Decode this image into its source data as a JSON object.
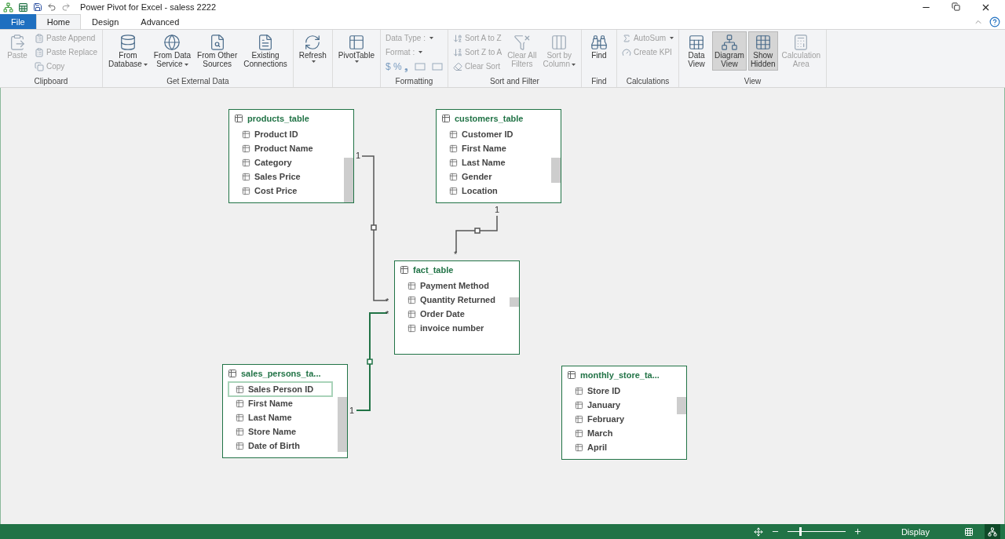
{
  "window": {
    "title": "Power Pivot for Excel - saless 2222"
  },
  "ribbon_tabs": [
    {
      "label": "File",
      "kind": "file",
      "selected": false
    },
    {
      "label": "Home",
      "kind": "tab",
      "selected": true
    },
    {
      "label": "Design",
      "kind": "tab",
      "selected": false
    },
    {
      "label": "Advanced",
      "kind": "tab",
      "selected": false
    }
  ],
  "ribbon_groups": [
    {
      "label": "Clipboard",
      "buttons": [
        {
          "kind": "large",
          "lines": [
            "Paste"
          ],
          "disabled": true,
          "dropdown": false
        },
        {
          "kind": "small",
          "lines": [
            "Paste Append"
          ],
          "disabled": true,
          "dropdown": false
        },
        {
          "kind": "small",
          "lines": [
            "Paste Replace"
          ],
          "disabled": true,
          "dropdown": false
        },
        {
          "kind": "small",
          "lines": [
            "Copy"
          ],
          "disabled": true,
          "dropdown": false
        }
      ]
    },
    {
      "label": "Get External Data",
      "buttons": [
        {
          "kind": "large",
          "lines": [
            "From",
            "Database"
          ],
          "disabled": false,
          "dropdown": true
        },
        {
          "kind": "large",
          "lines": [
            "From Data",
            "Service"
          ],
          "disabled": false,
          "dropdown": true
        },
        {
          "kind": "large",
          "lines": [
            "From Other",
            "Sources"
          ],
          "disabled": false,
          "dropdown": false
        },
        {
          "kind": "large",
          "lines": [
            "Existing",
            "Connections"
          ],
          "disabled": false,
          "dropdown": false
        }
      ]
    },
    {
      "buttons": [
        {
          "kind": "large",
          "lines": [
            "Refresh"
          ],
          "disabled": false,
          "dropdown": true
        }
      ]
    },
    {
      "buttons": [
        {
          "kind": "large",
          "lines": [
            "PivotTable"
          ],
          "disabled": false,
          "dropdown": true
        }
      ]
    },
    {
      "label": "Formatting",
      "buttons": [
        {
          "kind": "small",
          "lines": [
            "Data Type :"
          ],
          "disabled": true,
          "dropdown": true
        },
        {
          "kind": "small",
          "lines": [
            "Format :"
          ],
          "disabled": true,
          "dropdown": true
        },
        {
          "kind": "symbols",
          "lines": [
            "$",
            "%",
            "❟"
          ],
          "disabled": true,
          "dropdown": false
        }
      ]
    },
    {
      "label": "Sort and Filter",
      "buttons": [
        {
          "kind": "small",
          "lines": [
            "Sort A to Z"
          ],
          "disabled": true,
          "dropdown": false
        },
        {
          "kind": "small",
          "lines": [
            "Sort Z to A"
          ],
          "disabled": true,
          "dropdown": false
        },
        {
          "kind": "small",
          "lines": [
            "Clear Sort"
          ],
          "disabled": true,
          "dropdown": false
        },
        {
          "kind": "large",
          "lines": [
            "Clear All",
            "Filters"
          ],
          "disabled": true,
          "dropdown": false
        },
        {
          "kind": "large",
          "lines": [
            "Sort by",
            "Column"
          ],
          "disabled": true,
          "dropdown": true
        }
      ]
    },
    {
      "label": "Find",
      "buttons": [
        {
          "kind": "large",
          "lines": [
            "Find"
          ],
          "disabled": false,
          "dropdown": false
        }
      ]
    },
    {
      "label": "Calculations",
      "buttons": [
        {
          "kind": "small",
          "lines": [
            "AutoSum"
          ],
          "disabled": true,
          "dropdown": true
        },
        {
          "kind": "small",
          "lines": [
            "Create KPI"
          ],
          "disabled": true,
          "dropdown": false
        }
      ]
    },
    {
      "label": "View",
      "buttons": [
        {
          "kind": "large",
          "lines": [
            "Data",
            "View"
          ],
          "disabled": false,
          "dropdown": false,
          "selected": false
        },
        {
          "kind": "large",
          "lines": [
            "Diagram",
            "View"
          ],
          "disabled": false,
          "dropdown": false,
          "selected": true
        },
        {
          "kind": "large",
          "lines": [
            "Show",
            "Hidden"
          ],
          "disabled": false,
          "dropdown": false,
          "selected": true
        },
        {
          "kind": "large",
          "lines": [
            "Calculation",
            "Area"
          ],
          "disabled": true,
          "dropdown": false,
          "selected": false
        }
      ]
    }
  ],
  "diagram_tables": [
    {
      "title": "products_table",
      "rows": [
        {
          "label": "Product ID",
          "selected": false
        },
        {
          "label": "Product Name",
          "selected": false
        },
        {
          "label": "Category",
          "selected": false
        },
        {
          "label": "Sales Price",
          "selected": false
        },
        {
          "label": "Cost Price",
          "selected": false
        }
      ]
    },
    {
      "title": "customers_table",
      "rows": [
        {
          "label": "Customer ID",
          "selected": false
        },
        {
          "label": "First Name",
          "selected": false
        },
        {
          "label": "Last Name",
          "selected": false
        },
        {
          "label": "Gender",
          "selected": false
        },
        {
          "label": "Location",
          "selected": false
        }
      ]
    },
    {
      "title": "fact_table",
      "rows": [
        {
          "label": "Payment Method",
          "selected": false
        },
        {
          "label": "Quantity Returned",
          "selected": false
        },
        {
          "label": "Order Date",
          "selected": false
        },
        {
          "label": "invoice number",
          "selected": false
        }
      ]
    },
    {
      "title": "sales_persons_ta...",
      "rows": [
        {
          "label": "Sales Person ID",
          "selected": true
        },
        {
          "label": "First Name",
          "selected": false
        },
        {
          "label": "Last Name",
          "selected": false
        },
        {
          "label": "Store Name",
          "selected": false
        },
        {
          "label": "Date of Birth",
          "selected": false
        }
      ]
    },
    {
      "title": "monthly_store_ta...",
      "rows": [
        {
          "label": "Store ID",
          "selected": false
        },
        {
          "label": "January",
          "selected": false
        },
        {
          "label": "February",
          "selected": false
        },
        {
          "label": "March",
          "selected": false
        },
        {
          "label": "April",
          "selected": false
        }
      ]
    }
  ],
  "relationships": [
    {
      "one_label": "1",
      "many_label": "*",
      "selected": false
    },
    {
      "one_label": "1",
      "many_label": "*",
      "selected": false
    },
    {
      "one_label": "1",
      "many_label": "*",
      "selected": true
    }
  ],
  "status_bar": {
    "zoom": {
      "level": 0.2
    },
    "display_label": "Display",
    "view_buttons": [
      {
        "selected": false
      },
      {
        "selected": true
      }
    ]
  }
}
